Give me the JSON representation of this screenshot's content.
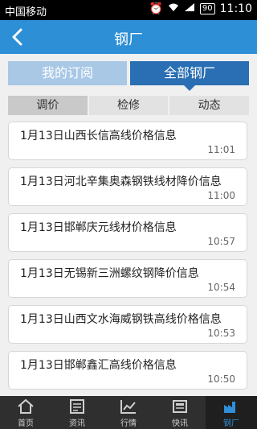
{
  "status": {
    "carrier": "中国移动",
    "battery": "90",
    "time": "11:10"
  },
  "header": {
    "title": "钢厂"
  },
  "segments": {
    "left": "我的订阅",
    "right": "全部钢厂"
  },
  "tabs": [
    "调价",
    "检修",
    "动态"
  ],
  "items": [
    {
      "title": "1月13日山西长信高线价格信息",
      "time": "11:01"
    },
    {
      "title": "1月13日河北辛集奥森钢铁线材降价信息",
      "time": "11:00"
    },
    {
      "title": "1月13日邯郸庆元线材价格信息",
      "time": "10:57"
    },
    {
      "title": "1月13日无锡新三洲螺纹钢降价信息",
      "time": "10:54"
    },
    {
      "title": "1月13日山西文水海威钢铁高线价格信息",
      "time": "10:53"
    },
    {
      "title": "1月13日邯郸鑫汇高线价格信息",
      "time": "10:50"
    }
  ],
  "nav": [
    {
      "label": "首页",
      "icon": "home-icon"
    },
    {
      "label": "资讯",
      "icon": "news-icon"
    },
    {
      "label": "行情",
      "icon": "chart-icon"
    },
    {
      "label": "快讯",
      "icon": "flash-news-icon"
    },
    {
      "label": "钢厂",
      "icon": "factory-icon"
    }
  ],
  "colors": {
    "accent": "#2d8fd6",
    "segment_active": "#2a6fb3",
    "segment_inactive": "#a8c8e6"
  }
}
